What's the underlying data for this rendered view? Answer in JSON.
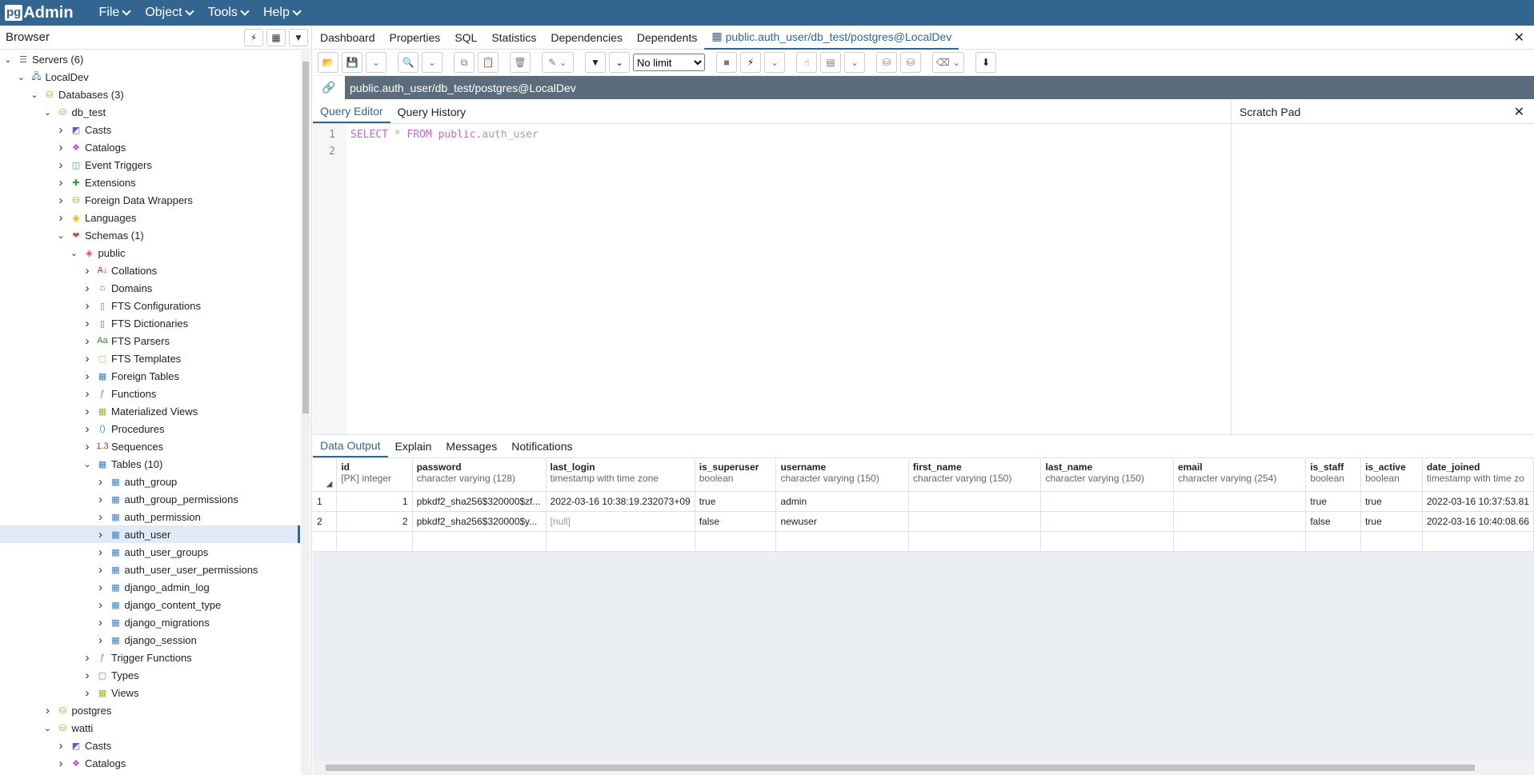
{
  "app": {
    "logo_pg": "pg",
    "logo_admin": "Admin"
  },
  "menu": [
    "File",
    "Object",
    "Tools",
    "Help"
  ],
  "browser": {
    "title": "Browser"
  },
  "tree": [
    {
      "label": "Servers (6)",
      "level": 0,
      "toggle": "open",
      "icon": "servers-icon"
    },
    {
      "label": "LocalDev",
      "level": 1,
      "toggle": "open",
      "icon": "server-icon"
    },
    {
      "label": "Databases (3)",
      "level": 2,
      "toggle": "open",
      "icon": "databases-icon"
    },
    {
      "label": "db_test",
      "level": 3,
      "toggle": "open",
      "icon": "database-icon"
    },
    {
      "label": "Casts",
      "level": 4,
      "toggle": "closed",
      "icon": "casts-icon"
    },
    {
      "label": "Catalogs",
      "level": 4,
      "toggle": "closed",
      "icon": "catalogs-icon"
    },
    {
      "label": "Event Triggers",
      "level": 4,
      "toggle": "closed",
      "icon": "event-triggers-icon"
    },
    {
      "label": "Extensions",
      "level": 4,
      "toggle": "closed",
      "icon": "extensions-icon"
    },
    {
      "label": "Foreign Data Wrappers",
      "level": 4,
      "toggle": "closed",
      "icon": "foreign-data-wrappers-icon"
    },
    {
      "label": "Languages",
      "level": 4,
      "toggle": "closed",
      "icon": "languages-icon"
    },
    {
      "label": "Schemas (1)",
      "level": 4,
      "toggle": "open",
      "icon": "schemas-icon"
    },
    {
      "label": "public",
      "level": 5,
      "toggle": "open",
      "icon": "schema-icon"
    },
    {
      "label": "Collations",
      "level": 6,
      "toggle": "closed",
      "icon": "collations-icon"
    },
    {
      "label": "Domains",
      "level": 6,
      "toggle": "closed",
      "icon": "domains-icon"
    },
    {
      "label": "FTS Configurations",
      "level": 6,
      "toggle": "closed",
      "icon": "fts-configurations-icon"
    },
    {
      "label": "FTS Dictionaries",
      "level": 6,
      "toggle": "closed",
      "icon": "fts-dictionaries-icon"
    },
    {
      "label": "FTS Parsers",
      "level": 6,
      "toggle": "closed",
      "icon": "fts-parsers-icon"
    },
    {
      "label": "FTS Templates",
      "level": 6,
      "toggle": "closed",
      "icon": "fts-templates-icon"
    },
    {
      "label": "Foreign Tables",
      "level": 6,
      "toggle": "closed",
      "icon": "foreign-tables-icon"
    },
    {
      "label": "Functions",
      "level": 6,
      "toggle": "closed",
      "icon": "functions-icon"
    },
    {
      "label": "Materialized Views",
      "level": 6,
      "toggle": "closed",
      "icon": "materialized-views-icon"
    },
    {
      "label": "Procedures",
      "level": 6,
      "toggle": "closed",
      "icon": "procedures-icon"
    },
    {
      "label": "Sequences",
      "level": 6,
      "toggle": "closed",
      "icon": "sequences-icon"
    },
    {
      "label": "Tables (10)",
      "level": 6,
      "toggle": "open",
      "icon": "tables-icon"
    },
    {
      "label": "auth_group",
      "level": 7,
      "toggle": "closed",
      "icon": "table-icon"
    },
    {
      "label": "auth_group_permissions",
      "level": 7,
      "toggle": "closed",
      "icon": "table-icon"
    },
    {
      "label": "auth_permission",
      "level": 7,
      "toggle": "closed",
      "icon": "table-icon"
    },
    {
      "label": "auth_user",
      "level": 7,
      "toggle": "closed",
      "icon": "table-icon",
      "selected": true
    },
    {
      "label": "auth_user_groups",
      "level": 7,
      "toggle": "closed",
      "icon": "table-icon"
    },
    {
      "label": "auth_user_user_permissions",
      "level": 7,
      "toggle": "closed",
      "icon": "table-icon"
    },
    {
      "label": "django_admin_log",
      "level": 7,
      "toggle": "closed",
      "icon": "table-icon"
    },
    {
      "label": "django_content_type",
      "level": 7,
      "toggle": "closed",
      "icon": "table-icon"
    },
    {
      "label": "django_migrations",
      "level": 7,
      "toggle": "closed",
      "icon": "table-icon"
    },
    {
      "label": "django_session",
      "level": 7,
      "toggle": "closed",
      "icon": "table-icon"
    },
    {
      "label": "Trigger Functions",
      "level": 6,
      "toggle": "closed",
      "icon": "trigger-functions-icon"
    },
    {
      "label": "Types",
      "level": 6,
      "toggle": "closed",
      "icon": "types-icon"
    },
    {
      "label": "Views",
      "level": 6,
      "toggle": "closed",
      "icon": "views-icon"
    },
    {
      "label": "postgres",
      "level": 3,
      "toggle": "closed",
      "icon": "database-icon"
    },
    {
      "label": "watti",
      "level": 3,
      "toggle": "open",
      "icon": "database-icon"
    },
    {
      "label": "Casts",
      "level": 4,
      "toggle": "closed",
      "icon": "casts-icon"
    },
    {
      "label": "Catalogs",
      "level": 4,
      "toggle": "closed",
      "icon": "catalogs-icon"
    }
  ],
  "tabs": [
    {
      "label": "Dashboard"
    },
    {
      "label": "Properties"
    },
    {
      "label": "SQL"
    },
    {
      "label": "Statistics"
    },
    {
      "label": "Dependencies"
    },
    {
      "label": "Dependents"
    },
    {
      "label": "public.auth_user/db_test/postgres@LocalDev",
      "active": true
    }
  ],
  "toolbar": {
    "limit": "No limit"
  },
  "connection": {
    "title": "public.auth_user/db_test/postgres@LocalDev"
  },
  "query_tabs": [
    "Query Editor",
    "Query History"
  ],
  "scratch_pad": {
    "title": "Scratch Pad"
  },
  "editor": {
    "lines": [
      "1",
      "2"
    ],
    "kw_select": "SELECT",
    "op_star": "*",
    "kw_from": "FROM",
    "schema": "public.",
    "table": "auth_user"
  },
  "output_tabs": [
    "Data Output",
    "Explain",
    "Messages",
    "Notifications"
  ],
  "columns": [
    {
      "name": "id",
      "type": "[PK] integer"
    },
    {
      "name": "password",
      "type": "character varying (128)"
    },
    {
      "name": "last_login",
      "type": "timestamp with time zone"
    },
    {
      "name": "is_superuser",
      "type": "boolean"
    },
    {
      "name": "username",
      "type": "character varying (150)"
    },
    {
      "name": "first_name",
      "type": "character varying (150)"
    },
    {
      "name": "last_name",
      "type": "character varying (150)"
    },
    {
      "name": "email",
      "type": "character varying (254)"
    },
    {
      "name": "is_staff",
      "type": "boolean"
    },
    {
      "name": "is_active",
      "type": "boolean"
    },
    {
      "name": "date_joined",
      "type": "timestamp with time zo"
    }
  ],
  "rows": [
    {
      "rownum": "1",
      "cells": [
        "1",
        "pbkdf2_sha256$320000$zf...",
        "2022-03-16 10:38:19.232073+09",
        "true",
        "admin",
        "",
        "",
        "",
        "true",
        "true",
        "2022-03-16 10:37:53.81"
      ]
    },
    {
      "rownum": "2",
      "cells": [
        "2",
        "pbkdf2_sha256$320000$y...",
        "[null]",
        "false",
        "newuser",
        "",
        "",
        "",
        "false",
        "true",
        "2022-03-16 10:40:08.66"
      ]
    }
  ]
}
